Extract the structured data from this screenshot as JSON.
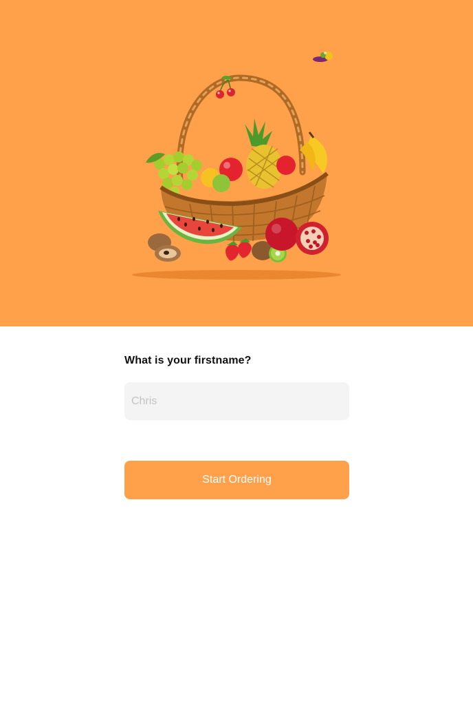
{
  "hero": {
    "image_name": "fruit-basket-illustration",
    "background_color": "#ffa04b"
  },
  "form": {
    "question": "What is your firstname?",
    "name_input": {
      "placeholder": "Chris",
      "value": ""
    },
    "start_button_label": "Start Ordering",
    "button_color": "#ffa04b",
    "input_background": "#f5f4f5"
  }
}
